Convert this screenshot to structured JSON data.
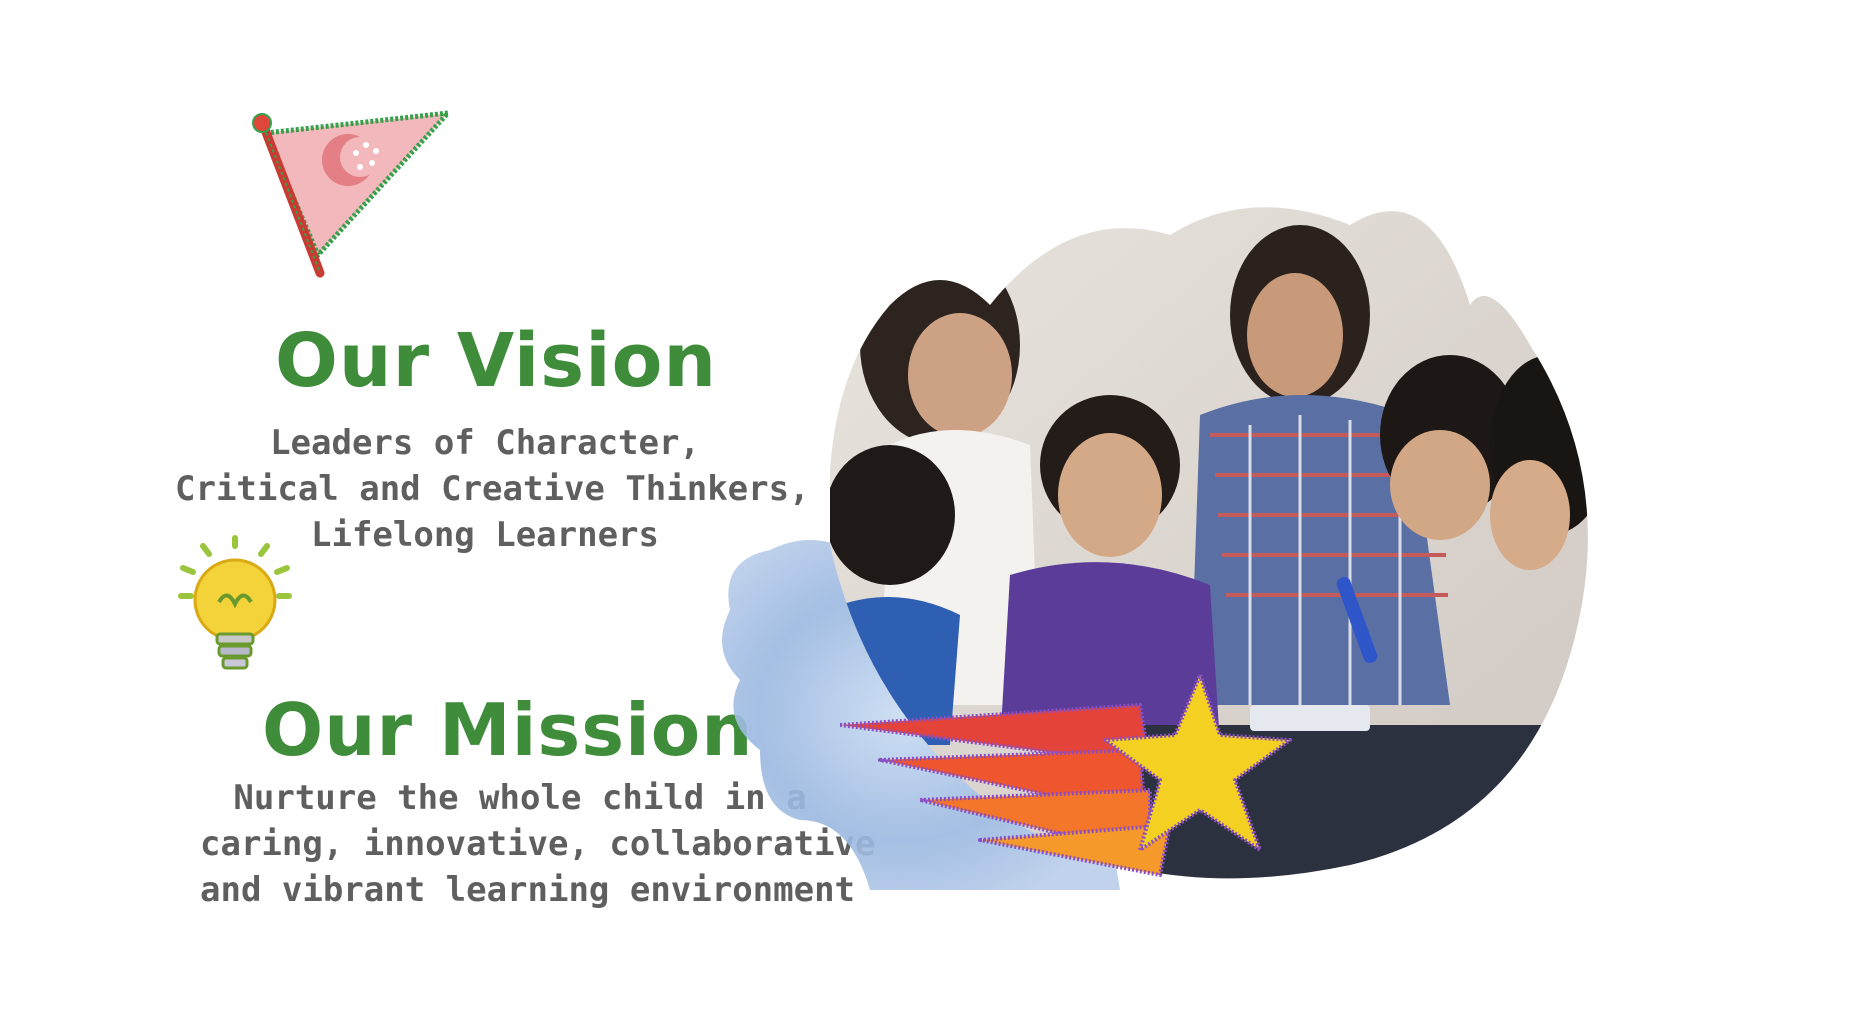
{
  "colors": {
    "heading": "#3f8d3a",
    "body_text": "#5f5f5f",
    "flag": "#e89aa0",
    "bulb": "#f4d23a",
    "star": "#f3d021",
    "watercolor": "#9ab8e0"
  },
  "icons": {
    "flag": "pennant-flag-icon",
    "bulb": "lightbulb-icon",
    "star": "shooting-star-icon"
  },
  "vision": {
    "title": "Our Vision",
    "lines": [
      "Leaders of Character,",
      "Critical and Creative Thinkers,",
      "Lifelong Learners"
    ]
  },
  "mission": {
    "title": "Our Mission",
    "lines": [
      "Nurture the whole child in a",
      "caring, innovative, collaborative",
      "and vibrant learning environment"
    ]
  }
}
